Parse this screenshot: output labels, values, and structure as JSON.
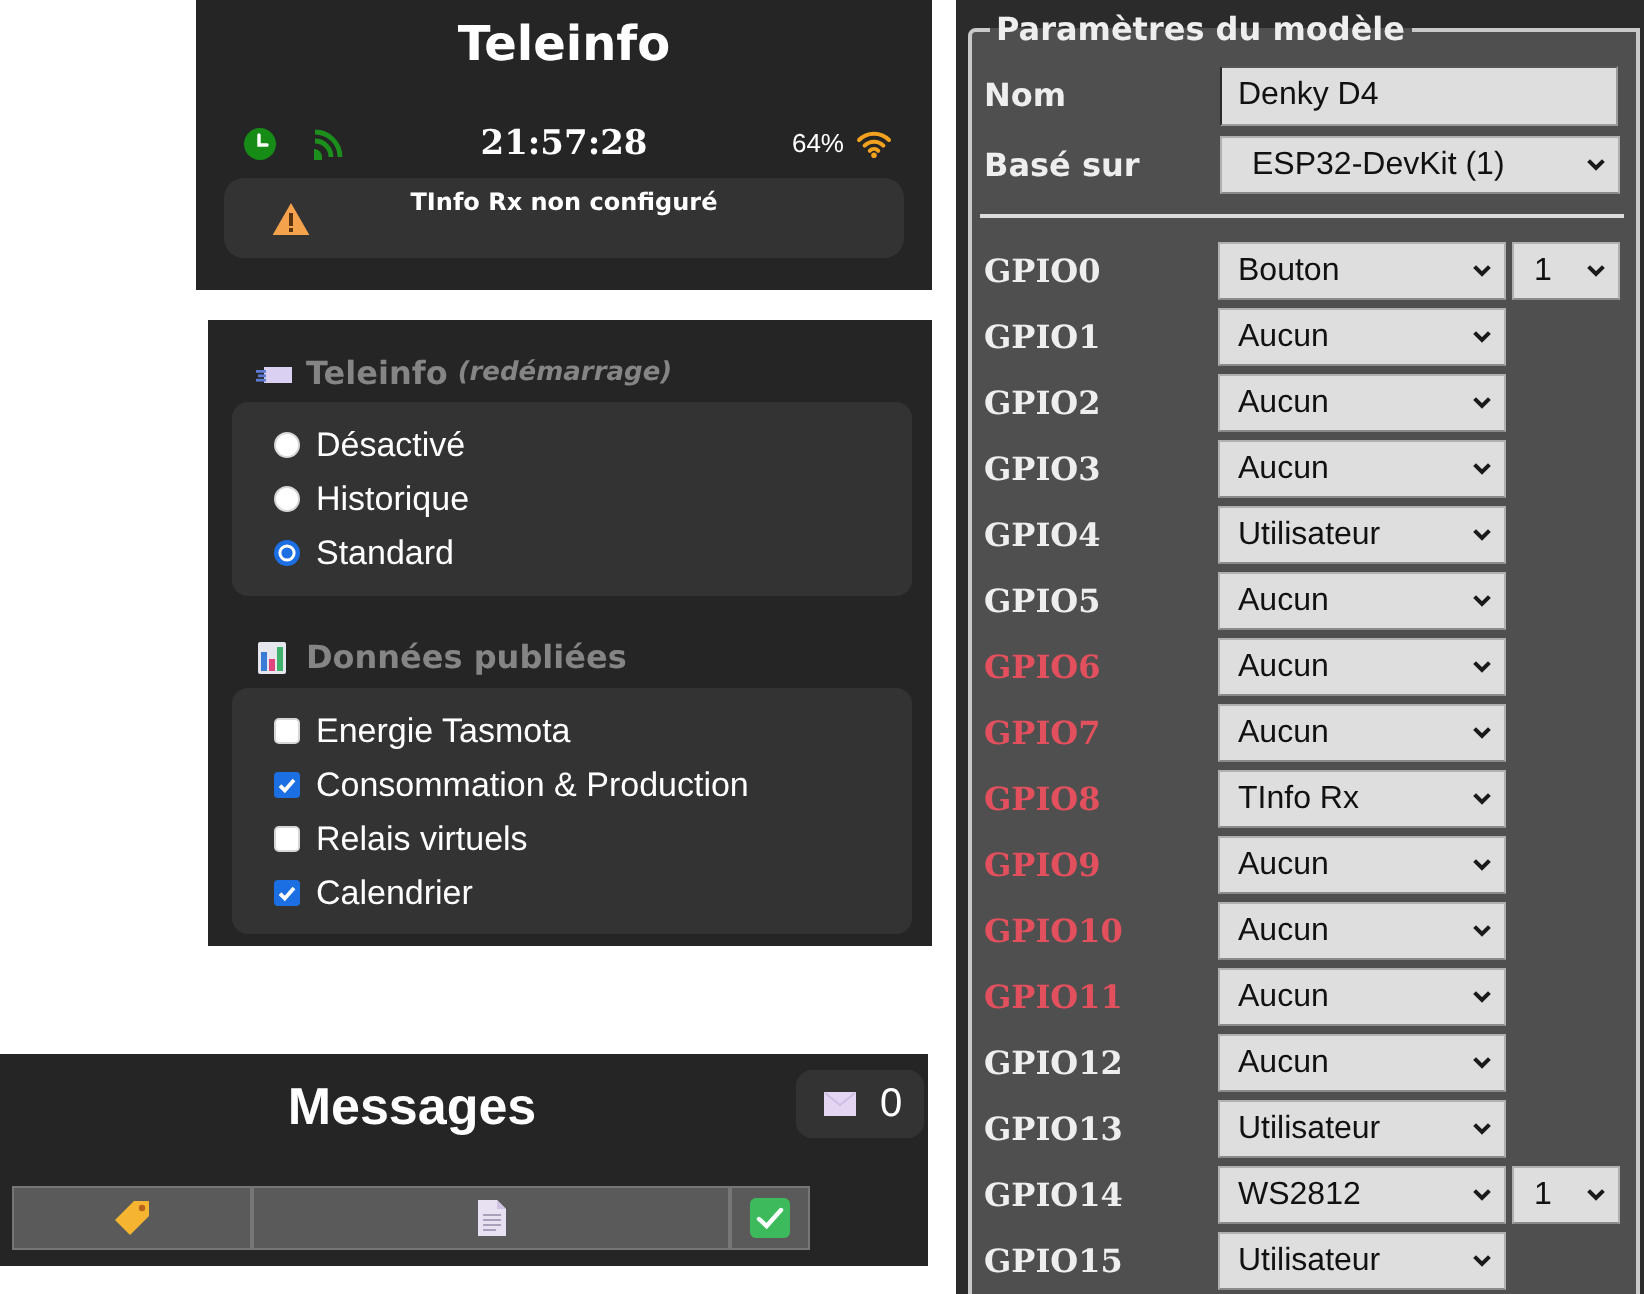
{
  "status_panel": {
    "title": "Teleinfo",
    "time": "21:57:28",
    "signal": "64%",
    "alert": "TInfo Rx non configuré"
  },
  "teleinfo_mode": {
    "title": "Teleinfo",
    "note": "(redémarrage)",
    "options": [
      {
        "label": "Désactivé",
        "selected": false
      },
      {
        "label": "Historique",
        "selected": false
      },
      {
        "label": "Standard",
        "selected": true
      }
    ]
  },
  "published_data": {
    "title": "Données publiées",
    "options": [
      {
        "label": "Energie Tasmota",
        "checked": false
      },
      {
        "label": "Consommation & Production",
        "checked": true
      },
      {
        "label": "Relais virtuels",
        "checked": false
      },
      {
        "label": "Calendrier",
        "checked": true
      }
    ]
  },
  "messages": {
    "title": "Messages",
    "count": "0"
  },
  "model_settings": {
    "legend": "Paramètres du modèle",
    "fields": [
      {
        "kind": "text",
        "label": "Nom",
        "value": "Denky D4"
      },
      {
        "kind": "select",
        "label": "Basé sur",
        "value": "ESP32-DevKit (1)"
      }
    ],
    "gpios": [
      {
        "label": "GPIO0",
        "reserved": false,
        "function": "Bouton",
        "index": "1"
      },
      {
        "label": "GPIO1",
        "reserved": false,
        "function": "Aucun"
      },
      {
        "label": "GPIO2",
        "reserved": false,
        "function": "Aucun"
      },
      {
        "label": "GPIO3",
        "reserved": false,
        "function": "Aucun"
      },
      {
        "label": "GPIO4",
        "reserved": false,
        "function": "Utilisateur"
      },
      {
        "label": "GPIO5",
        "reserved": false,
        "function": "Aucun"
      },
      {
        "label": "GPIO6",
        "reserved": true,
        "function": "Aucun"
      },
      {
        "label": "GPIO7",
        "reserved": true,
        "function": "Aucun"
      },
      {
        "label": "GPIO8",
        "reserved": true,
        "function": "TInfo Rx"
      },
      {
        "label": "GPIO9",
        "reserved": true,
        "function": "Aucun"
      },
      {
        "label": "GPIO10",
        "reserved": true,
        "function": "Aucun"
      },
      {
        "label": "GPIO11",
        "reserved": true,
        "function": "Aucun"
      },
      {
        "label": "GPIO12",
        "reserved": false,
        "function": "Aucun"
      },
      {
        "label": "GPIO13",
        "reserved": false,
        "function": "Utilisateur"
      },
      {
        "label": "GPIO14",
        "reserved": false,
        "function": "WS2812",
        "index": "1"
      },
      {
        "label": "GPIO15",
        "reserved": false,
        "function": "Utilisateur"
      }
    ]
  }
}
